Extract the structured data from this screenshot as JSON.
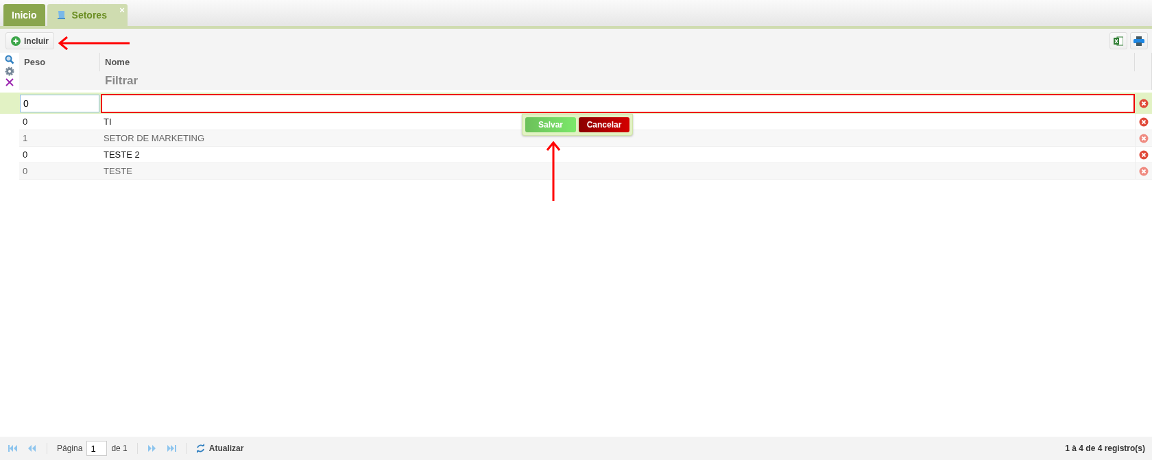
{
  "tabs": [
    {
      "label": "Inicio",
      "selected": false
    },
    {
      "label": "Setores",
      "selected": true,
      "close": "×"
    }
  ],
  "toolbar": {
    "add_button": "Incluir"
  },
  "grid": {
    "columns": [
      "Peso",
      "Nome"
    ],
    "filter_label": "Filtrar",
    "edit_row": {
      "peso_value": "0",
      "edit_buttons": [
        "Salvar",
        "Cancelar"
      ]
    },
    "rows": [
      {
        "peso": "0",
        "nome": "TI"
      },
      {
        "peso": "1",
        "nome": "SETOR DE MARKETING"
      },
      {
        "peso": "0",
        "nome": "TESTE 2"
      },
      {
        "peso": "0",
        "nome": "TESTE"
      }
    ]
  },
  "annotations": [
    {
      "kind": "left-arrow"
    },
    {
      "kind": "up-arrow"
    }
  ],
  "footer": {
    "page_label": "Página",
    "page_value": "1",
    "page_total": "de 1",
    "refresh": "Atualizar",
    "summary": "1 à 4 de 4 registro(s)"
  }
}
